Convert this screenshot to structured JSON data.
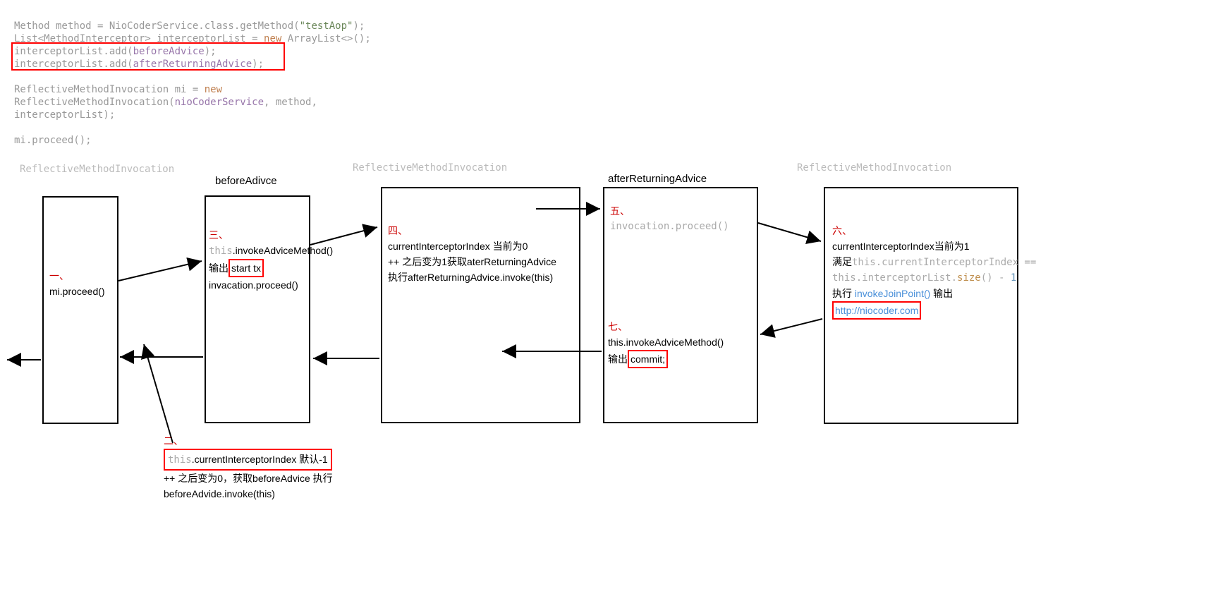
{
  "code": {
    "l1_a": "Method method = NioCoderService.",
    "l1_b": "class",
    "l1_c": ".getMethod(",
    "l1_d": "\"testAop\"",
    "l1_e": ");",
    "l2_a": "List<MethodInterceptor> interceptorList = ",
    "l2_b": "new",
    "l2_c": " ArrayList<>();",
    "l3_a": "interceptorList.add(",
    "l3_b": "beforeAdvice",
    "l3_c": ");",
    "l4_a": "interceptorList.add(",
    "l4_b": "afterReturningAdvice",
    "l4_c": ");",
    "l5_a": "ReflectiveMethodInvocation mi = ",
    "l5_b": "new",
    "l6_a": "ReflectiveMethodInvocation(",
    "l6_b": "nioCoderService",
    "l6_c": ", method,",
    "l7_a": "interceptorList);",
    "l8_a": "mi.proceed();"
  },
  "lanes": {
    "t1": "ReflectiveMethodInvocation",
    "t2": "beforeAdivce",
    "t3": "ReflectiveMethodInvocation",
    "t4": "afterReturningAdvice",
    "t5": "ReflectiveMethodInvocation"
  },
  "box1": {
    "step": "一、",
    "line1": "mi.proceed()"
  },
  "box2": {
    "step": "三、",
    "line1_pre": "this",
    "line1_post": ".invokeAdviceMethod()",
    "line2_pre": "输出",
    "line2_box": "start tx",
    "line3": "invacation.proceed()"
  },
  "box2_below": {
    "step": "二、",
    "line1_pre": "this",
    "line1_post": ".currentInterceptorIndex 默认-1",
    "line2": "++ 之后变为0，获取beforeAdvice 执行",
    "line3": "beforeAdvide.invoke(this)"
  },
  "box3": {
    "step": "四、",
    "line1": "currentInterceptorIndex 当前为0",
    "line2": "++ 之后变为1获取aterReturningAdvice",
    "line3": "执行afterReturningAdvice.invoke(this)"
  },
  "box4_top": {
    "step": "五、",
    "line1": "invocation.proceed()"
  },
  "box4_mid": {
    "step": "七、",
    "line1": "this.invokeAdviceMethod()",
    "line2_pre": "输出",
    "line2_box": "commit;"
  },
  "box5": {
    "step": "六、",
    "line1": "currentInterceptorIndex当前为1",
    "line2_pre": "满足",
    "line2_code1_a": "this",
    "line2_code1_b": ".currentInterceptorIndex ==",
    "line3_a": "this",
    "line3_b": ".interceptorList.",
    "line3_c": "size",
    "line3_d": "() - ",
    "line3_e": "1",
    "line4_pre": "执行 ",
    "line4_link": "invokeJoinPoint()",
    "line4_post": " 输出",
    "line5": "http://niocoder.com"
  }
}
